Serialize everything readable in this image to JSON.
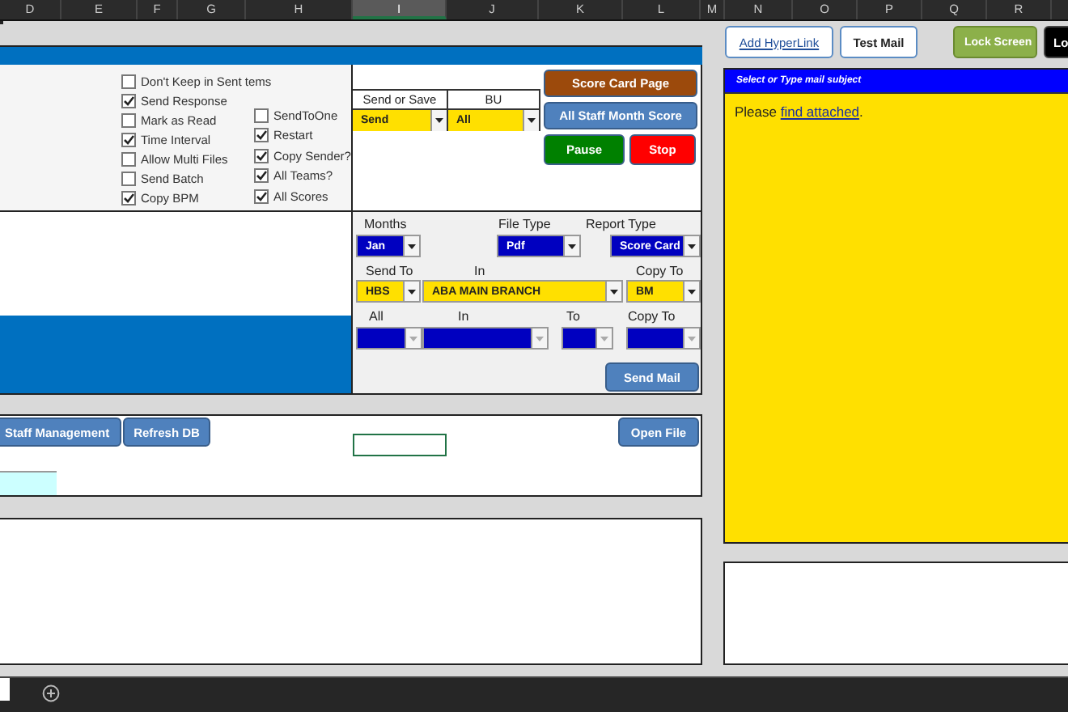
{
  "column_headers": [
    {
      "label": "D",
      "selected": false
    },
    {
      "label": "E",
      "selected": false
    },
    {
      "label": "F",
      "selected": false
    },
    {
      "label": "G",
      "selected": false
    },
    {
      "label": "H",
      "selected": false
    },
    {
      "label": "I",
      "selected": true
    },
    {
      "label": "J",
      "selected": false
    },
    {
      "label": "K",
      "selected": false
    },
    {
      "label": "L",
      "selected": false
    },
    {
      "label": "M",
      "selected": false
    },
    {
      "label": "N",
      "selected": false
    },
    {
      "label": "O",
      "selected": false
    },
    {
      "label": "P",
      "selected": false
    },
    {
      "label": "Q",
      "selected": false
    },
    {
      "label": "R",
      "selected": false
    }
  ],
  "top_buttons": [
    {
      "label": "Add HyperLink",
      "kind": "link"
    },
    {
      "label": "Test Mail",
      "kind": "outline"
    },
    {
      "label": "Lock Screen",
      "kind": "green"
    },
    {
      "label": "Lo",
      "kind": "dark"
    }
  ],
  "options_left": [
    {
      "label": "Don't Keep in Sent tems",
      "checked": false
    },
    {
      "label": "Send Response",
      "checked": true
    },
    {
      "label": "Mark as Read",
      "checked": false
    },
    {
      "label": "Time Interval",
      "checked": true
    },
    {
      "label": "Allow Multi Files",
      "checked": false
    },
    {
      "label": "Send Batch",
      "checked": false
    },
    {
      "label": "Copy BPM",
      "checked": true
    }
  ],
  "options_right": [
    {
      "label": "SendToOne",
      "checked": false
    },
    {
      "label": "Restart",
      "checked": true
    },
    {
      "label": "Copy Sender?",
      "checked": true
    },
    {
      "label": "All Teams?",
      "checked": true
    },
    {
      "label": "All Scores",
      "checked": true
    }
  ],
  "selectors": [
    {
      "label": "Send or Save",
      "value": "Send"
    },
    {
      "label": "BU",
      "value": "All"
    }
  ],
  "action_buttons": [
    {
      "label": "Score Card Page",
      "kind": "brown"
    },
    {
      "label": "All Staff Month Score",
      "kind": "blue"
    },
    {
      "label": "Pause",
      "kind": "green"
    },
    {
      "label": "Stop",
      "kind": "red"
    }
  ],
  "report_rows": [
    {
      "fields": [
        {
          "label": "Months",
          "value": "Jan",
          "kind": "blue",
          "disabled": false
        },
        {
          "label": "File Type",
          "value": "Pdf",
          "kind": "blue",
          "disabled": false
        },
        {
          "label": "Report Type",
          "value": "Score Card",
          "kind": "blue",
          "disabled": false
        }
      ]
    },
    {
      "fields": [
        {
          "label": "Send To",
          "value": "HBS",
          "kind": "yellow",
          "disabled": false
        },
        {
          "label": "In",
          "value": "ABA MAIN BRANCH",
          "kind": "yellow",
          "disabled": false
        },
        {
          "label": "Copy To",
          "value": "BM",
          "kind": "yellow",
          "disabled": false
        }
      ]
    },
    {
      "fields": [
        {
          "label": "All",
          "kind": "blue",
          "disabled": true
        },
        {
          "label": "In",
          "kind": "blue",
          "disabled": true
        },
        {
          "label": "To",
          "kind": "blue",
          "disabled": true
        },
        {
          "label": "Copy To",
          "kind": "blue",
          "disabled": true
        }
      ]
    }
  ],
  "send_mail_button": "Send Mail",
  "sheet_buttons": [
    "Staff Management",
    "Refresh DB"
  ],
  "open_file_button": "Open File",
  "mail_subject_header": "Select or Type mail subject",
  "mail_body": {
    "before": "Please ",
    "link": "find attached",
    "after": "."
  }
}
